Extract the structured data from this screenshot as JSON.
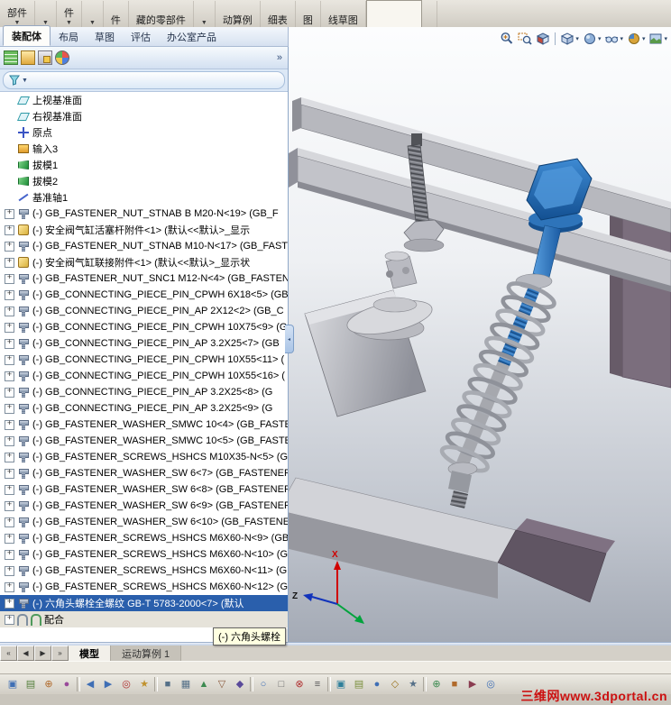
{
  "ribbon": {
    "buttons": [
      {
        "label": "部件",
        "arrow": "▼"
      },
      {
        "label": "",
        "arrow": "▼"
      },
      {
        "label": "件",
        "arrow": "▼"
      },
      {
        "label": "",
        "arrow": "▼"
      },
      {
        "label": "件",
        "arrow": ""
      },
      {
        "label": "藏的零部件",
        "arrow": ""
      },
      {
        "label": "",
        "arrow": "▼"
      },
      {
        "label": "动算例",
        "arrow": ""
      },
      {
        "label": "细表",
        "arrow": ""
      },
      {
        "label": "图",
        "arrow": ""
      },
      {
        "label": "线草图",
        "arrow": ""
      },
      {
        "label": "",
        "arrow": "",
        "pressed": "true"
      },
      {
        "label": "",
        "arrow": ""
      }
    ]
  },
  "tabs": {
    "items": [
      {
        "label": "装配体",
        "active": "true"
      },
      {
        "label": "布局"
      },
      {
        "label": "草图"
      },
      {
        "label": "评估"
      },
      {
        "label": "办公室产品"
      }
    ]
  },
  "panel": {
    "overflow": "»",
    "filter_arrow": "▼"
  },
  "tree": {
    "items": [
      {
        "icon": "plane",
        "label": "上视基准面"
      },
      {
        "icon": "plane",
        "label": "右视基准面"
      },
      {
        "icon": "origin",
        "label": "原点"
      },
      {
        "icon": "import",
        "label": "输入3"
      },
      {
        "icon": "draft",
        "label": "拔模1"
      },
      {
        "icon": "draft",
        "label": "拔模2"
      },
      {
        "icon": "axis",
        "label": "基准轴1"
      },
      {
        "icon": "bolt",
        "expand": "true",
        "label": "(-) GB_FASTENER_NUT_STNAB  B M20-N<19> (GB_F"
      },
      {
        "icon": "part",
        "expand": "true",
        "label": "(-) 安全阀气缸活塞杆附件<1> (默认<<默认>_显示"
      },
      {
        "icon": "bolt",
        "expand": "true",
        "label": "(-) GB_FASTENER_NUT_STNAB M10-N<17> (GB_FAST"
      },
      {
        "icon": "part",
        "expand": "true",
        "label": "(-) 安全阀气缸联接附件<1> (默认<<默认>_显示状"
      },
      {
        "icon": "bolt",
        "expand": "true",
        "label": "(-) GB_FASTENER_NUT_SNC1 M12-N<4> (GB_FASTEN"
      },
      {
        "icon": "bolt",
        "expand": "true",
        "label": "(-) GB_CONNECTING_PIECE_PIN_CPWH 6X18<5> (GB_"
      },
      {
        "icon": "bolt",
        "expand": "true",
        "label": "(-) GB_CONNECTING_PIECE_PIN_AP 2X12<2> (GB_C"
      },
      {
        "icon": "bolt",
        "expand": "true",
        "label": "(-) GB_CONNECTING_PIECE_PIN_CPWH 10X75<9> (G"
      },
      {
        "icon": "bolt",
        "expand": "true",
        "label": "(-) GB_CONNECTING_PIECE_PIN_AP 3.2X25<7> (GB"
      },
      {
        "icon": "bolt",
        "expand": "true",
        "label": "(-) GB_CONNECTING_PIECE_PIN_CPWH 10X55<11> ("
      },
      {
        "icon": "bolt",
        "expand": "true",
        "label": "(-) GB_CONNECTING_PIECE_PIN_CPWH 10X55<16> ("
      },
      {
        "icon": "bolt",
        "expand": "true",
        "label": "(-) GB_CONNECTING_PIECE_PIN_AP 3.2X25<8> (G"
      },
      {
        "icon": "bolt",
        "expand": "true",
        "label": "(-) GB_CONNECTING_PIECE_PIN_AP 3.2X25<9> (G"
      },
      {
        "icon": "bolt",
        "expand": "true",
        "label": "(-) GB_FASTENER_WASHER_SMWC 10<4> (GB_FASTEN"
      },
      {
        "icon": "bolt",
        "expand": "true",
        "label": "(-) GB_FASTENER_WASHER_SMWC 10<5> (GB_FASTE"
      },
      {
        "icon": "bolt",
        "expand": "true",
        "label": "(-) GB_FASTENER_SCREWS_HSHCS M10X35-N<5> (GB"
      },
      {
        "icon": "bolt",
        "expand": "true",
        "label": "(-) GB_FASTENER_WASHER_SW 6<7> (GB_FASTENER_"
      },
      {
        "icon": "bolt",
        "expand": "true",
        "label": "(-) GB_FASTENER_WASHER_SW 6<8> (GB_FASTENER_"
      },
      {
        "icon": "bolt",
        "expand": "true",
        "label": "(-) GB_FASTENER_WASHER_SW 6<9> (GB_FASTENER_"
      },
      {
        "icon": "bolt",
        "expand": "true",
        "label": "(-) GB_FASTENER_WASHER_SW 6<10> (GB_FASTENER"
      },
      {
        "icon": "bolt",
        "expand": "true",
        "label": "(-) GB_FASTENER_SCREWS_HSHCS M6X60-N<9> (GB_"
      },
      {
        "icon": "bolt",
        "expand": "true",
        "label": "(-) GB_FASTENER_SCREWS_HSHCS M6X60-N<10> (G"
      },
      {
        "icon": "bolt",
        "expand": "true",
        "label": "(-) GB_FASTENER_SCREWS_HSHCS M6X60-N<11> (G"
      },
      {
        "icon": "bolt",
        "expand": "true",
        "label": "(-) GB_FASTENER_SCREWS_HSHCS M6X60-N<12> (G"
      },
      {
        "icon": "bolt",
        "expand": "true",
        "selected": "true",
        "label": "(-) 六角头螺栓全螺纹  GB-T 5783-2000<7> (默认"
      }
    ]
  },
  "mates": {
    "label": "配合"
  },
  "tooltip": {
    "text": "(-) 六角头螺栓"
  },
  "viewport": {
    "watermark": "三维网www.3dportal.cn",
    "triad": {
      "x": "X",
      "z": "Z"
    },
    "hud_icons": [
      "zoom-fit",
      "zoom-area",
      "section-view",
      "view-orientation",
      "display-style",
      "hide-show",
      "edit-appearance",
      "apply-scene"
    ]
  },
  "bottom": {
    "status": "",
    "nav": [
      "«",
      "◀",
      "▶",
      "»"
    ],
    "tabs": [
      {
        "label": "模型",
        "active": "true"
      },
      {
        "label": "运动算例 1"
      }
    ],
    "toolbar": {
      "icons": [
        {
          "g": "▣",
          "c": "#3f6fb5"
        },
        {
          "g": "▤",
          "c": "#55803c"
        },
        {
          "g": "⊕",
          "c": "#b06a2a"
        },
        {
          "g": "●",
          "c": "#9a4a9a"
        },
        {
          "g": "",
          "sep": "true"
        },
        {
          "g": "◀",
          "c": "#3f6fb5"
        },
        {
          "g": "▶",
          "c": "#3f6fb5"
        },
        {
          "g": "◎",
          "c": "#b03030"
        },
        {
          "g": "★",
          "c": "#c0922e"
        },
        {
          "g": "",
          "sep": "true"
        },
        {
          "g": "■",
          "c": "#557088"
        },
        {
          "g": "▦",
          "c": "#557088"
        },
        {
          "g": "▲",
          "c": "#3c8a50"
        },
        {
          "g": "▽",
          "c": "#8a5a3c"
        },
        {
          "g": "◆",
          "c": "#5a4a9a"
        },
        {
          "g": "",
          "sep": "true"
        },
        {
          "g": "○",
          "c": "#3f6fb5"
        },
        {
          "g": "□",
          "c": "#6a6a6a"
        },
        {
          "g": "⊗",
          "c": "#b03030"
        },
        {
          "g": "≡",
          "c": "#555555"
        },
        {
          "g": "",
          "sep": "true"
        },
        {
          "g": "▣",
          "c": "#2e7f9a"
        },
        {
          "g": "▤",
          "c": "#7a8f3c"
        },
        {
          "g": "●",
          "c": "#3f6fb5"
        },
        {
          "g": "◇",
          "c": "#9a7420"
        },
        {
          "g": "★",
          "c": "#557088"
        },
        {
          "g": "",
          "sep": "true"
        },
        {
          "g": "⊕",
          "c": "#3c8a50"
        },
        {
          "g": "■",
          "c": "#b06a2a"
        },
        {
          "g": "▶",
          "c": "#8a3c50"
        },
        {
          "g": "◎",
          "c": "#3f6fb5"
        }
      ]
    }
  }
}
